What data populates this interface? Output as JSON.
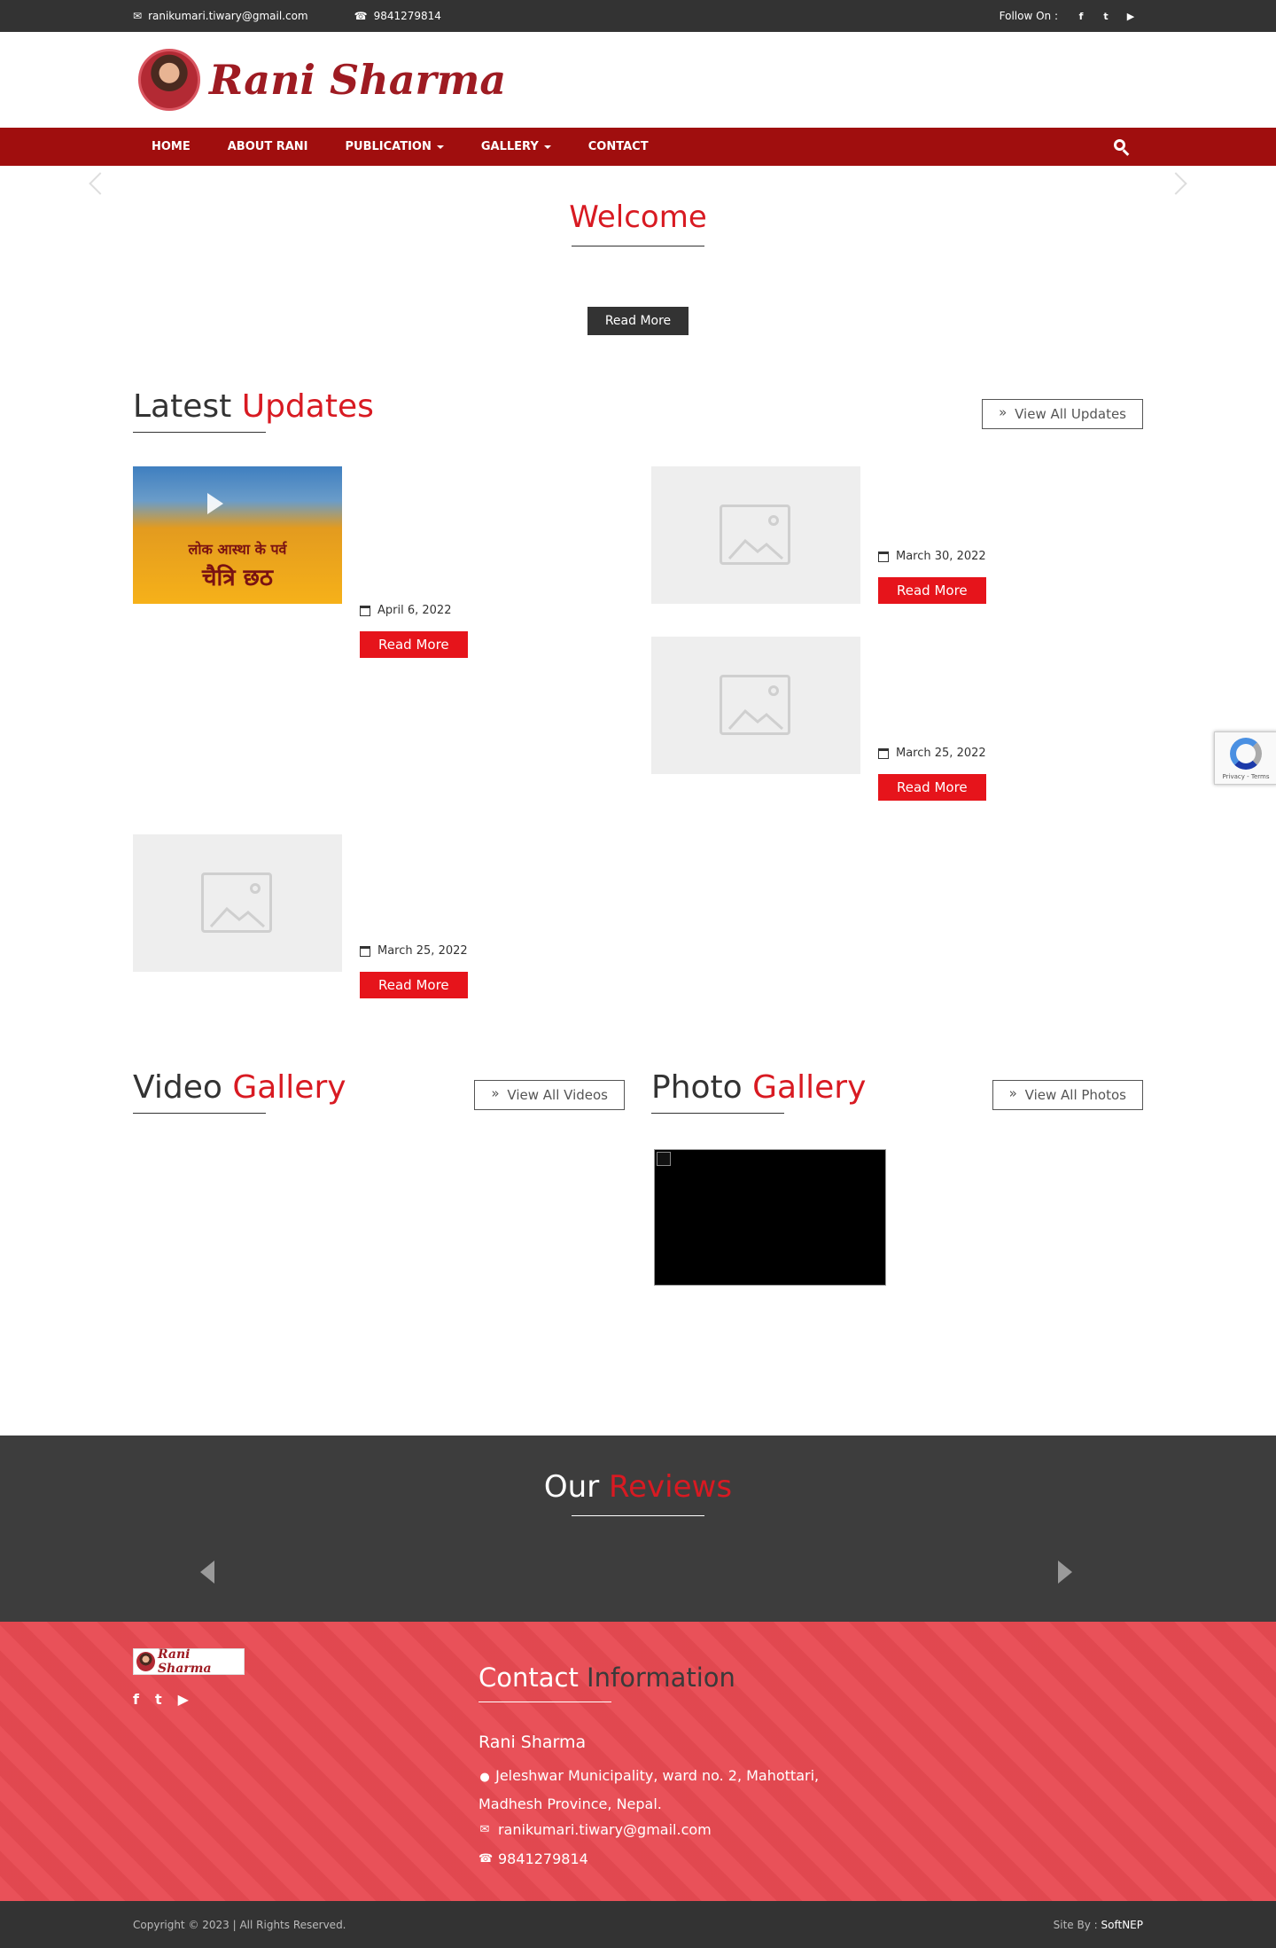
{
  "topbar": {
    "email": "ranikumari.tiwary@gmail.com",
    "phone": "9841279814",
    "follow_label": "Follow On :",
    "social": [
      "f",
      "t",
      "yt"
    ]
  },
  "header": {
    "logo_text": "Rani Sharma"
  },
  "nav": {
    "items": [
      {
        "label": "HOME",
        "dropdown": false
      },
      {
        "label": "ABOUT RANI",
        "dropdown": false
      },
      {
        "label": "PUBLICATION",
        "dropdown": true
      },
      {
        "label": "GALLERY",
        "dropdown": true
      },
      {
        "label": "CONTACT",
        "dropdown": false
      }
    ],
    "search_icon": "search-icon"
  },
  "welcome": {
    "title": "Welcome",
    "button": "Read More"
  },
  "latest": {
    "title_plain": "Latest",
    "title_accent": "Updates",
    "view_all": "View All Updates",
    "items": [
      {
        "date": "April 6, 2022",
        "button": "Read More",
        "thumb": "photo",
        "thumb_text1": "लोक आस्था के पर्व",
        "thumb_text2": "चैत्रि छठ"
      },
      {
        "date": "March 30, 2022",
        "button": "Read More",
        "thumb": "placeholder"
      },
      {
        "date": "March 25, 2022",
        "button": "Read More",
        "thumb": "placeholder"
      },
      {
        "date": "March 25, 2022",
        "button": "Read More",
        "thumb": "placeholder"
      }
    ]
  },
  "video_gallery": {
    "title_plain": "Video",
    "title_accent": "Gallery",
    "view_all": "View All Videos"
  },
  "photo_gallery": {
    "title_plain": "Photo",
    "title_accent": "Gallery",
    "view_all": "View All Photos"
  },
  "reviews": {
    "title_plain": "Our",
    "title_accent": "Reviews"
  },
  "footer": {
    "logo_text": "Rani Sharma",
    "social": [
      "f",
      "t",
      "yt"
    ],
    "contact_title_1": "Contact",
    "contact_title_2": "Information",
    "name": "Rani Sharma",
    "address_line1": "Jeleshwar Municipality, ward no. 2, Mahottari,",
    "address_line2": "Madhesh Province, Nepal.",
    "email": "ranikumari.tiwary@gmail.com",
    "phone": "9841279814"
  },
  "bottombar": {
    "copyright": "Copyright © 2023 | All Rights Reserved.",
    "siteby_label": "Site By :",
    "siteby_name": "SoftNEP"
  },
  "recaptcha": {
    "text": "Privacy - Terms"
  },
  "colors": {
    "accent_red": "#d81a22",
    "nav_red": "#a00e0e",
    "button_red": "#e6141b",
    "dark": "#333333",
    "footer_red": "#e84a52"
  }
}
